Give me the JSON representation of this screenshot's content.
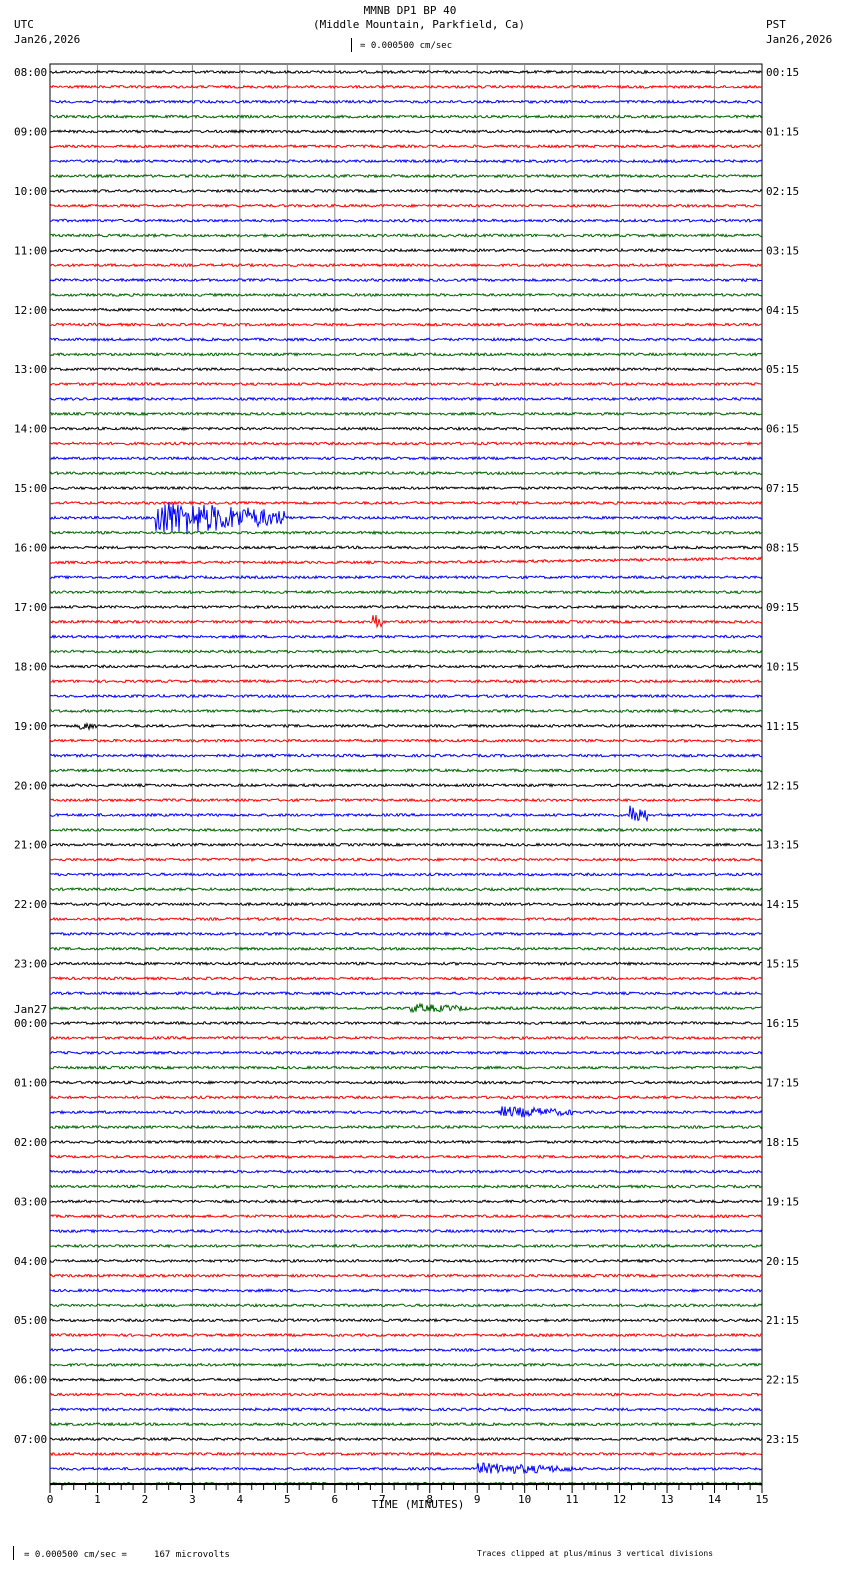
{
  "header": {
    "title": "MMNB DP1 BP 40",
    "subtitle": "(Middle Mountain, Parkfield, Ca)",
    "left_tz": "UTC",
    "left_date": "Jan26,2026",
    "right_tz": "PST",
    "right_date": "Jan26,2026",
    "scale": "= 0.000500 cm/sec"
  },
  "footer": {
    "scale": "= 0.000500 cm/sec =     167 microvolts",
    "clip_note": "Traces clipped at plus/minus 3 vertical divisions"
  },
  "chart_data": {
    "type": "line",
    "title": "MMNB DP1 BP 40",
    "xlabel": "TIME (MINUTES)",
    "xlim": [
      0,
      15
    ],
    "x_ticks": [
      "0",
      "1",
      "2",
      "3",
      "4",
      "5",
      "6",
      "7",
      "8",
      "9",
      "10",
      "11",
      "12",
      "13",
      "14",
      "15"
    ],
    "traces_per_hour": 4,
    "trace_colors": [
      "#000000",
      "#ff0000",
      "#0000ff",
      "#006400"
    ],
    "utc_labels": [
      "08:00",
      "09:00",
      "10:00",
      "11:00",
      "12:00",
      "13:00",
      "14:00",
      "15:00",
      "16:00",
      "17:00",
      "18:00",
      "19:00",
      "20:00",
      "21:00",
      "22:00",
      "23:00",
      "00:00",
      "01:00",
      "02:00",
      "03:00",
      "04:00",
      "05:00",
      "06:00",
      "07:00"
    ],
    "date_change_label": "Jan27",
    "pst_labels": [
      "00:15",
      "01:15",
      "02:15",
      "03:15",
      "04:15",
      "05:15",
      "06:15",
      "07:15",
      "08:15",
      "09:15",
      "10:15",
      "11:15",
      "12:15",
      "13:15",
      "14:15",
      "15:15",
      "16:15",
      "17:15",
      "18:15",
      "19:15",
      "20:15",
      "21:15",
      "22:15",
      "23:15"
    ],
    "events": [
      {
        "trace": 30,
        "start_min": 2.2,
        "end_min": 5.0,
        "amplitude": 3
      },
      {
        "trace": 37,
        "start_min": 6.8,
        "end_min": 7.0,
        "amplitude": 1.5
      },
      {
        "trace": 50,
        "start_min": 12.2,
        "end_min": 12.6,
        "amplitude": 2
      },
      {
        "trace": 70,
        "start_min": 9.5,
        "end_min": 11.0,
        "amplitude": 0.8
      },
      {
        "trace": 94,
        "start_min": 9.0,
        "end_min": 11.0,
        "amplitude": 0.8
      },
      {
        "trace": 63,
        "start_min": 7.6,
        "end_min": 8.8,
        "amplitude": 0.6
      },
      {
        "trace": 44,
        "start_min": 0.6,
        "end_min": 1.0,
        "amplitude": 0.6
      }
    ],
    "grid": true
  }
}
